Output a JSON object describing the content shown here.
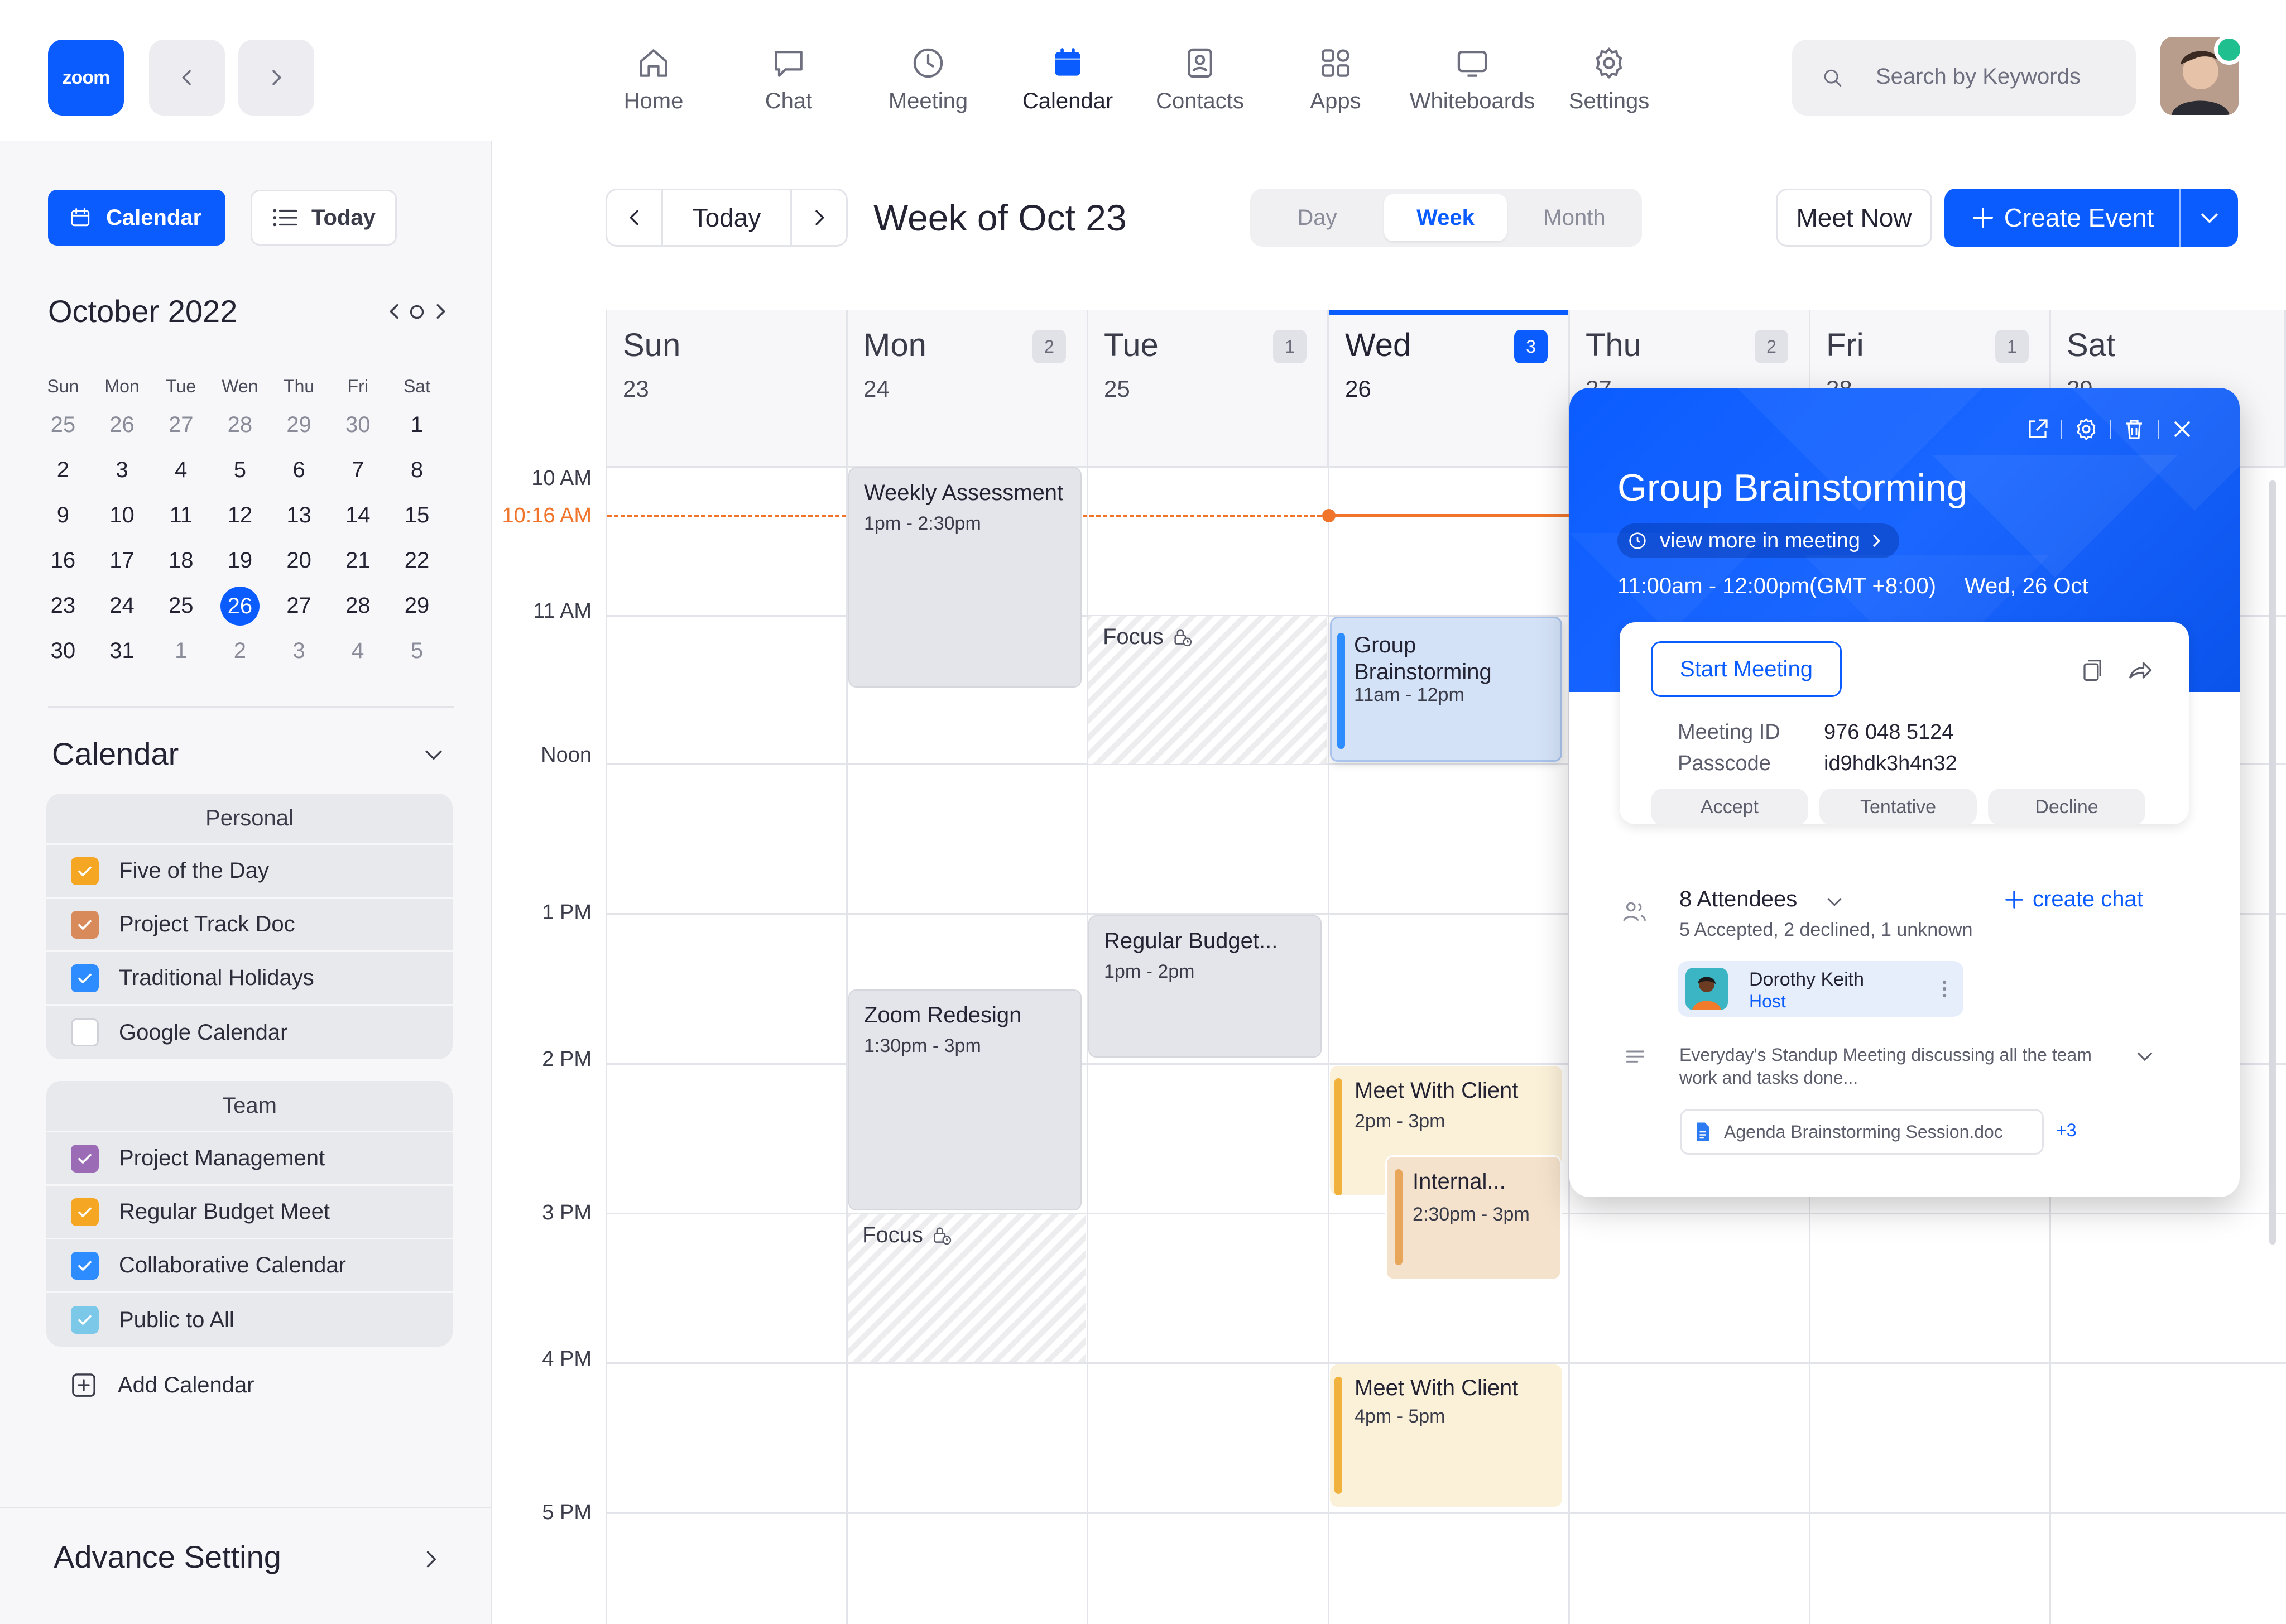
{
  "topbar": {
    "logo": "zoom",
    "tabs": [
      {
        "label": "Home",
        "icon": "home-icon"
      },
      {
        "label": "Chat",
        "icon": "chat-icon"
      },
      {
        "label": "Meeting",
        "icon": "clock-icon"
      },
      {
        "label": "Calendar",
        "icon": "calendar-icon"
      },
      {
        "label": "Contacts",
        "icon": "contacts-icon"
      },
      {
        "label": "Apps",
        "icon": "apps-icon"
      },
      {
        "label": "Whiteboards",
        "icon": "whiteboard-icon"
      },
      {
        "label": "Settings",
        "icon": "gear-icon"
      }
    ],
    "active_tab": "Calendar",
    "search_placeholder": "Search by Keywords"
  },
  "sidebar": {
    "calendar_button": "Calendar",
    "today_button": "Today",
    "month_title": "October 2022",
    "weekdays": [
      "Sun",
      "Mon",
      "Tue",
      "Wen",
      "Thu",
      "Fri",
      "Sat"
    ],
    "weeks": [
      [
        "25",
        "26",
        "27",
        "28",
        "29",
        "30",
        "1"
      ],
      [
        "2",
        "3",
        "4",
        "5",
        "6",
        "7",
        "8"
      ],
      [
        "9",
        "10",
        "11",
        "12",
        "13",
        "14",
        "15"
      ],
      [
        "16",
        "17",
        "18",
        "19",
        "20",
        "21",
        "22"
      ],
      [
        "23",
        "24",
        "25",
        "26",
        "27",
        "28",
        "29"
      ],
      [
        "30",
        "31",
        "1",
        "2",
        "3",
        "4",
        "5"
      ]
    ],
    "selected_day": "26",
    "calendar_section_title": "Calendar",
    "personal": {
      "title": "Personal",
      "items": [
        {
          "label": "Five of the Day",
          "checked": true,
          "color": "#F5A623"
        },
        {
          "label": "Project Track Doc",
          "checked": true,
          "color": "#D98A5B"
        },
        {
          "label": "Traditional Holidays",
          "checked": true,
          "color": "#2D8CFF"
        },
        {
          "label": "Google Calendar",
          "checked": false,
          "color": "#FFFFFF"
        }
      ]
    },
    "team": {
      "title": "Team",
      "items": [
        {
          "label": "Project Management",
          "checked": true,
          "color": "#9B6BB5"
        },
        {
          "label": "Regular Budget Meet",
          "checked": true,
          "color": "#F5A623"
        },
        {
          "label": "Collaborative Calendar",
          "checked": true,
          "color": "#2D8CFF"
        },
        {
          "label": "Public to All",
          "checked": true,
          "color": "#7CC8E8"
        }
      ]
    },
    "add_calendar": "Add Calendar",
    "advance_setting": "Advance Setting"
  },
  "toolbar": {
    "today": "Today",
    "week_title": "Week of Oct 23",
    "views": [
      "Day",
      "Week",
      "Month"
    ],
    "active_view": "Week",
    "meet_now": "Meet Now",
    "create_event": "Create Event"
  },
  "days": [
    {
      "name": "Sun",
      "date": "23",
      "badge": ""
    },
    {
      "name": "Mon",
      "date": "24",
      "badge": "2"
    },
    {
      "name": "Tue",
      "date": "25",
      "badge": "1"
    },
    {
      "name": "Wed",
      "date": "26",
      "badge": "3"
    },
    {
      "name": "Thu",
      "date": "27",
      "badge": "2"
    },
    {
      "name": "Fri",
      "date": "28",
      "badge": "1"
    },
    {
      "name": "Sat",
      "date": "29",
      "badge": ""
    }
  ],
  "time_labels": [
    "10 AM",
    "11 AM",
    "Noon",
    "1 PM",
    "2 PM",
    "3 PM",
    "4 PM",
    "5 PM"
  ],
  "current_time": "10:16 AM",
  "events": {
    "weekly_assessment": {
      "title": "Weekly Assessment",
      "time": "1pm - 2:30pm"
    },
    "focus_tue": {
      "title": "Focus"
    },
    "group_brainstorming": {
      "title": "Group Brainstorming",
      "time": "11am - 12pm"
    },
    "regular_budget": {
      "title": "Regular Budget...",
      "time": "1pm - 2pm"
    },
    "zoom_redesign": {
      "title": "Zoom Redesign",
      "time": "1:30pm - 3pm"
    },
    "focus_mon": {
      "title": "Focus"
    },
    "meet_client_1": {
      "title": "Meet With Client",
      "time": "2pm - 3pm"
    },
    "internal": {
      "title": "Internal...",
      "time": "2:30pm - 3pm"
    },
    "meet_client_2": {
      "title": "Meet With Client",
      "time": "4pm - 5pm"
    }
  },
  "popup": {
    "title": "Group Brainstorming",
    "view_more": "view more in meeting",
    "time": "11:00am - 12:00pm(GMT +8:00)",
    "date": "Wed, 26 Oct",
    "start_meeting": "Start Meeting",
    "meeting_id_label": "Meeting ID",
    "meeting_id": "976 048 5124",
    "passcode_label": "Passcode",
    "passcode": "id9hdk3h4n32",
    "accept": "Accept",
    "tentative": "Tentative",
    "decline": "Decline",
    "attendees": "8 Attendees",
    "attendees_summary": "5 Accepted, 2 declined, 1 unknown",
    "create_chat": "create chat",
    "host_name": "Dorothy Keith",
    "host_role": "Host",
    "description": "Everyday's Standup Meeting discussing all the team work and tasks done...",
    "attachment": "Agenda Brainstorming Session.doc",
    "more_attachments": "+3"
  },
  "colors": {
    "accent": "#0B5CFF",
    "now_line": "#F0752B"
  }
}
